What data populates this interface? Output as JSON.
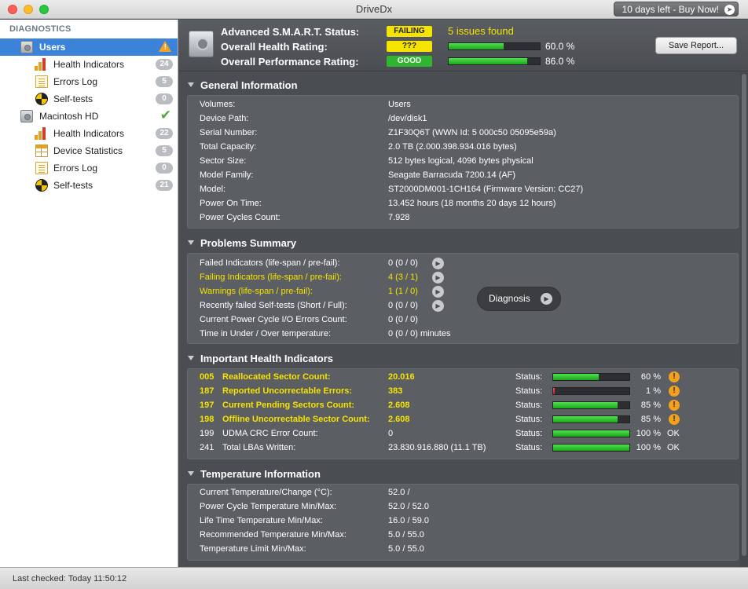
{
  "window": {
    "title": "DriveDx",
    "buy_label": "10 days left - Buy Now!"
  },
  "sidebar": {
    "header": "DIAGNOSTICS",
    "drives": [
      {
        "name": "Users",
        "status": "warning",
        "items": [
          {
            "label": "Health Indicators",
            "count": "24",
            "icon": "bar-chart-icon"
          },
          {
            "label": "Errors Log",
            "count": "5",
            "icon": "log-icon"
          },
          {
            "label": "Self-tests",
            "count": "0",
            "icon": "self-test-icon"
          }
        ]
      },
      {
        "name": "Macintosh HD",
        "status": "ok",
        "items": [
          {
            "label": "Health Indicators",
            "count": "22",
            "icon": "bar-chart-icon"
          },
          {
            "label": "Device Statistics",
            "count": "5",
            "icon": "table-icon"
          },
          {
            "label": "Errors Log",
            "count": "0",
            "icon": "log-icon"
          },
          {
            "label": "Self-tests",
            "count": "21",
            "icon": "self-test-icon"
          }
        ]
      }
    ]
  },
  "header": {
    "smart_label": "Advanced S.M.A.R.T. Status:",
    "smart_status": "FAILING",
    "issues": "5 issues found",
    "health_label": "Overall Health Rating:",
    "health_status": "???",
    "health_pct": "60.0 %",
    "health_value": 60,
    "perf_label": "Overall Performance Rating:",
    "perf_status": "GOOD",
    "perf_pct": "86.0 %",
    "perf_value": 86,
    "save_label": "Save Report..."
  },
  "general": {
    "title": "General Information",
    "rows": [
      {
        "label": "Volumes:",
        "value": "Users"
      },
      {
        "label": "Device Path:",
        "value": "/dev/disk1"
      },
      {
        "label": "Serial Number:",
        "value": "Z1F30Q6T (WWN Id: 5 000c50 05095e59a)"
      },
      {
        "label": "Total Capacity:",
        "value": "2.0 TB (2.000.398.934.016 bytes)"
      },
      {
        "label": "Sector Size:",
        "value": "512 bytes logical, 4096 bytes physical"
      },
      {
        "label": "Model Family:",
        "value": "Seagate Barracuda 7200.14 (AF)"
      },
      {
        "label": "Model:",
        "value": "ST2000DM001-1CH164  (Firmware Version: CC27)"
      },
      {
        "label": "Power On Time:",
        "value": "13.452 hours (18 months 20 days 12 hours)"
      },
      {
        "label": "Power Cycles Count:",
        "value": "7.928"
      }
    ]
  },
  "problems": {
    "title": "Problems Summary",
    "diagnosis_label": "Diagnosis",
    "rows": [
      {
        "label": "Failed Indicators (life-span / pre-fail):",
        "value": "0 (0 / 0)",
        "highlight": false,
        "button": true
      },
      {
        "label": "Failing Indicators (life-span / pre-fail):",
        "value": "4 (3 / 1)",
        "highlight": true,
        "button": true
      },
      {
        "label": "Warnings (life-span / pre-fail):",
        "value": "1 (1 / 0)",
        "highlight": true,
        "button": true
      },
      {
        "label": "Recently failed Self-tests (Short / Full):",
        "value": "0 (0 / 0)",
        "highlight": false,
        "button": true
      },
      {
        "label": "Current Power Cycle I/O Errors Count:",
        "value": "0 (0 / 0)",
        "highlight": false,
        "button": false
      },
      {
        "label": "Time in Under / Over temperature:",
        "value": "0 (0 / 0)   minutes",
        "highlight": false,
        "button": false
      }
    ]
  },
  "indicators": {
    "title": "Important Health Indicators",
    "status_label": "Status:",
    "rows": [
      {
        "id": "005",
        "name": "Reallocated Sector Count:",
        "value": "20.016",
        "pct": "60 %",
        "level": 60,
        "warn": true,
        "highlight": true,
        "ok_label": ""
      },
      {
        "id": "187",
        "name": "Reported Uncorrectable Errors:",
        "value": "383",
        "pct": "1 %",
        "level": 1,
        "warn": true,
        "highlight": true,
        "ok_label": ""
      },
      {
        "id": "197",
        "name": "Current Pending Sectors Count:",
        "value": "2.608",
        "pct": "85 %",
        "level": 85,
        "warn": true,
        "highlight": true,
        "ok_label": ""
      },
      {
        "id": "198",
        "name": "Offline Uncorrectable Sector Count:",
        "value": "2.608",
        "pct": "85 %",
        "level": 85,
        "warn": true,
        "highlight": true,
        "ok_label": ""
      },
      {
        "id": "199",
        "name": "UDMA CRC Error Count:",
        "value": "0",
        "pct": "100 %",
        "level": 100,
        "warn": false,
        "highlight": false,
        "ok_label": "OK"
      },
      {
        "id": "241",
        "name": "Total LBAs Written:",
        "value": "23.830.916.880 (11.1 TB)",
        "pct": "100 %",
        "level": 100,
        "warn": false,
        "highlight": false,
        "ok_label": "OK"
      }
    ]
  },
  "temperature": {
    "title": "Temperature Information",
    "rows": [
      {
        "label": "Current Temperature/Change (°C):",
        "value": "52.0 /"
      },
      {
        "label": "Power Cycle Temperature Min/Max:",
        "value": "52.0 / 52.0"
      },
      {
        "label": "Life Time Temperature Min/Max:",
        "value": "16.0 / 59.0"
      },
      {
        "label": "Recommended Temperature Min/Max:",
        "value": "5.0   / 55.0"
      },
      {
        "label": "Temperature Limit Min/Max:",
        "value": "5.0   / 55.0"
      }
    ]
  },
  "status_bar": {
    "text": "Last checked: Today 11:50:12"
  }
}
